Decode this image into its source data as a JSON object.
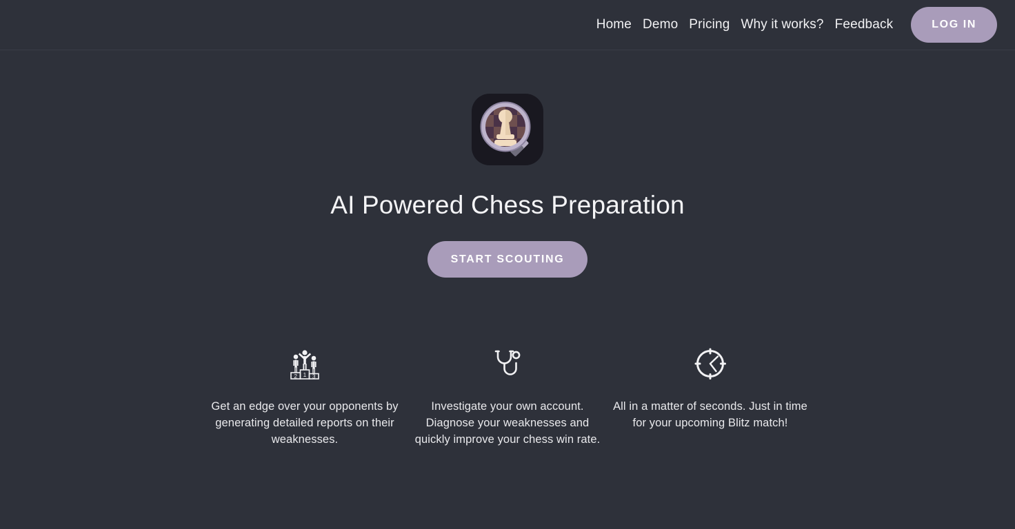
{
  "theme": {
    "background": "#2e313a",
    "accent": "#a99cba",
    "text": "#f4f4f6",
    "muted_text": "#e9e9ec",
    "border": "#3a3d47",
    "logo_background": "#191820"
  },
  "header": {
    "nav": [
      {
        "label": "Home",
        "name": "nav-home"
      },
      {
        "label": "Demo",
        "name": "nav-demo"
      },
      {
        "label": "Pricing",
        "name": "nav-pricing"
      },
      {
        "label": "Why it works?",
        "name": "nav-why-it-works"
      },
      {
        "label": "Feedback",
        "name": "nav-feedback"
      }
    ],
    "login_label": "LOG IN"
  },
  "hero": {
    "logo_icon": "chess-pawn-magnifier-logo-icon",
    "title": "AI Powered Chess Preparation",
    "cta_label": "START SCOUTING"
  },
  "features": [
    {
      "icon": "podium-ranking-icon",
      "podium_labels": [
        "2",
        "1",
        "3"
      ],
      "text": "Get an edge over your opponents by generating detailed reports on their weaknesses."
    },
    {
      "icon": "stethoscope-icon",
      "text": "Investigate your own account. Diagnose your weaknesses and quickly improve your chess win rate."
    },
    {
      "icon": "clock-icon",
      "text": "All in a matter of seconds. Just in time for your upcoming Blitz match!"
    }
  ]
}
